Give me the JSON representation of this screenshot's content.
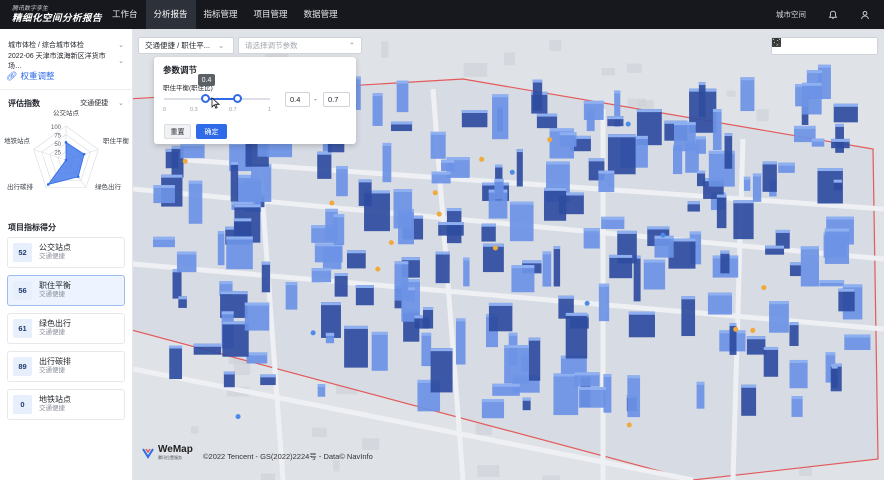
{
  "header": {
    "logo_sub": "腾讯数字孪生",
    "logo_main": "精细化空间分析报告",
    "nav": [
      "工作台",
      "分析报告",
      "指标管理",
      "项目管理",
      "数据管理"
    ],
    "active_nav": "分析报告",
    "city_space": "城市空间"
  },
  "sidebar": {
    "breadcrumb": "城市体检 / 综合城市体检",
    "project": "2022-06 天津市滨海新区洋货市场…",
    "weight_adjust": "权重调整",
    "eval_title": "评估指数",
    "eval_select": "交通便捷",
    "radar": {
      "axes": [
        "公交站点",
        "职住平衡",
        "绿色出行",
        "出行碳排",
        "地铁站点"
      ],
      "values": [
        52,
        56,
        61,
        89,
        0
      ],
      "ticks": [
        "100",
        "75",
        "50",
        "25"
      ]
    },
    "project_scores_title": "项目指标得分",
    "cards": [
      {
        "score": "52",
        "name": "公交站点",
        "category": "交通便捷"
      },
      {
        "score": "56",
        "name": "职住平衡",
        "category": "交通便捷"
      },
      {
        "score": "61",
        "name": "绿色出行",
        "category": "交通便捷"
      },
      {
        "score": "89",
        "name": "出行碳排",
        "category": "交通便捷"
      },
      {
        "score": "0",
        "name": "地铁站点",
        "category": "交通便捷"
      }
    ],
    "active_card": 1
  },
  "map": {
    "select1": "交通便捷 / 职住平...",
    "select2_placeholder": "请选择调节参数",
    "tools": [
      "sidebar-toggle-icon",
      "layers-icon",
      "pie-chart-icon",
      "settings-icon",
      "person-icon"
    ],
    "attribution": "©2022 Tencent - GS(2022)2224号 - Data© NavInfo",
    "wemap_name": "WeMap",
    "wemap_sub": "腾讯位置服务"
  },
  "param_panel": {
    "title": "参数调节",
    "label": "职住平衡(职住比)",
    "tooltip": "0.4",
    "ticks": [
      "0",
      "0.3",
      "0.7",
      "1"
    ],
    "min_value": "0.4",
    "max_value": "0.7",
    "range_low": 0.4,
    "range_high": 0.7,
    "separator": "-",
    "reset": "重置",
    "confirm": "确定"
  },
  "colors": {
    "accent": "#2f6be8",
    "nav_bg": "#16181d",
    "building_dark": "#2f4c9f",
    "building_light": "#6d93e6",
    "boundary": "#e35a5a"
  }
}
